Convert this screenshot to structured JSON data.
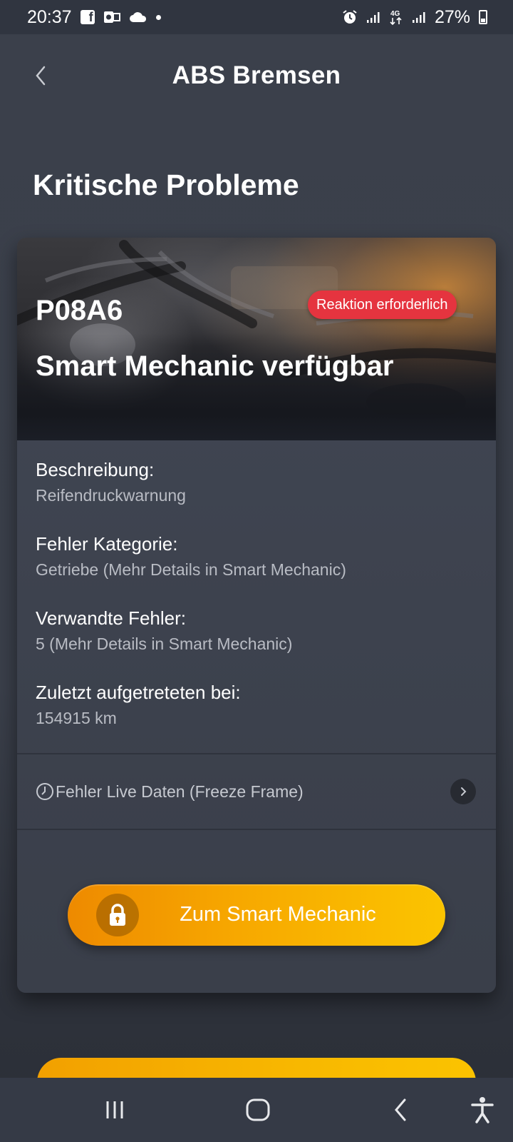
{
  "status_bar": {
    "time": "20:37",
    "battery": "27%",
    "icons": [
      "facebook-icon",
      "outlook-icon",
      "cloud-icon",
      "dot-icon",
      "alarm-icon",
      "signal-icon",
      "4g-icon",
      "signal-icon",
      "battery-icon"
    ]
  },
  "header": {
    "title": "ABS Bremsen",
    "back_icon": "chevron-left-icon"
  },
  "section": {
    "title": "Kritische Probleme"
  },
  "card": {
    "fault_code": "P08A6",
    "badge": "Reaktion erforderlich",
    "badge_color": "#e5343f",
    "subtitle": "Smart Mechanic verfügbar",
    "info": [
      {
        "label": "Beschreibung:",
        "value": "Reifendruckwarnung"
      },
      {
        "label": "Fehler Kategorie:",
        "value": "Getriebe  (Mehr Details in Smart Mechanic)"
      },
      {
        "label": "Verwandte Fehler:",
        "value": "5  (Mehr Details in Smart Mechanic)"
      },
      {
        "label": "Zuletzt aufgetreteten bei:",
        "value": "154915 km"
      }
    ],
    "freeze_frame_label": "Fehler Live Daten (Freeze Frame)",
    "cta_label": "Zum Smart Mechanic",
    "cta_color": "#f7a800"
  },
  "nav_bar": {
    "buttons": [
      "recent-apps-icon",
      "home-icon",
      "back-icon",
      "accessibility-icon"
    ]
  }
}
